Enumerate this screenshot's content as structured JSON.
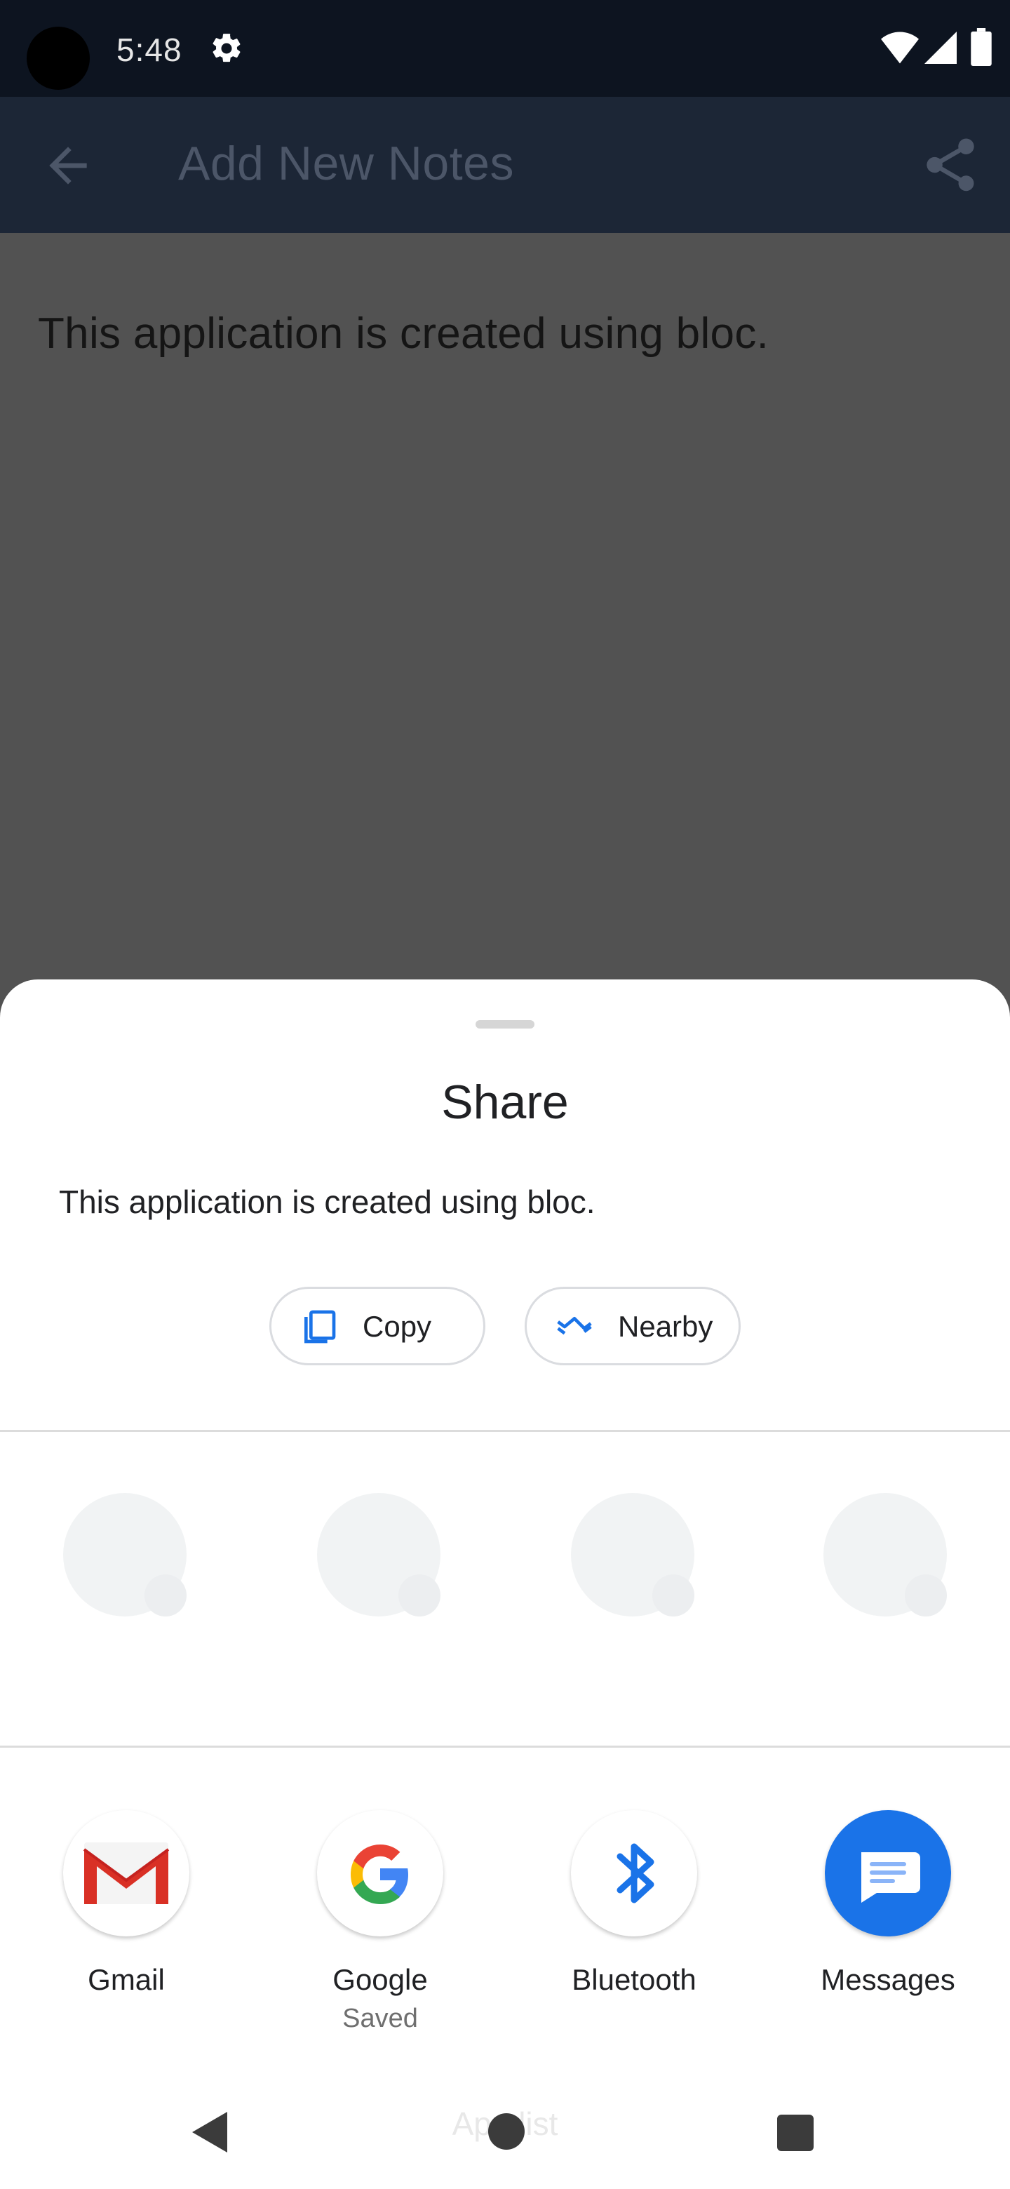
{
  "status_bar": {
    "time": "5:48"
  },
  "app_bar": {
    "title": "Add New Notes",
    "back_icon": "arrow-back-icon",
    "share_icon": "share-icon"
  },
  "note": {
    "body": "This application is created using bloc."
  },
  "share_sheet": {
    "title": "Share",
    "shared_text": "This application is created using bloc.",
    "actions": [
      {
        "label": "Copy",
        "icon": "copy-icon"
      },
      {
        "label": "Nearby",
        "icon": "nearby-share-icon"
      }
    ],
    "targets": [
      {
        "label": "Gmail",
        "sublabel": "",
        "icon": "gmail-icon"
      },
      {
        "label": "Google",
        "sublabel": "Saved",
        "icon": "google-icon"
      },
      {
        "label": "Bluetooth",
        "sublabel": "",
        "icon": "bluetooth-icon"
      },
      {
        "label": "Messages",
        "sublabel": "",
        "icon": "messages-icon"
      }
    ]
  },
  "nav_bar": {
    "peek_text": "App list"
  },
  "colors": {
    "status_bar": "#0d1420",
    "app_bar": "#1c2636",
    "scrim_background": "#525252",
    "accent_blue": "#1a73e8"
  }
}
